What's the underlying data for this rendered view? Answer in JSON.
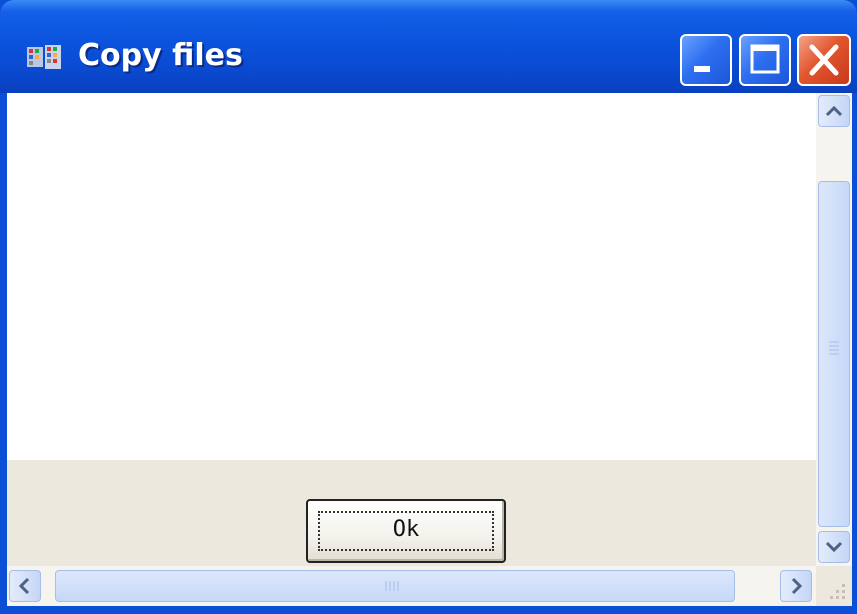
{
  "window": {
    "title": "Copy files",
    "title_icon": "copy-files-app-icon",
    "controls": {
      "minimize_icon": "minimize-icon",
      "maximize_icon": "maximize-icon",
      "close_icon": "close-icon"
    }
  },
  "dialog": {
    "ok_label": "Ok"
  },
  "scrollbars": {
    "vertical": {
      "up_icon": "chevron-up-icon",
      "down_icon": "chevron-down-icon"
    },
    "horizontal": {
      "left_icon": "chevron-left-icon",
      "right_icon": "chevron-right-icon"
    }
  },
  "colors": {
    "titlebar": "#0b53dc",
    "close_button": "#e2562e",
    "panel": "#ede8dd",
    "scrollbar_thumb": "#c6d8f7"
  }
}
